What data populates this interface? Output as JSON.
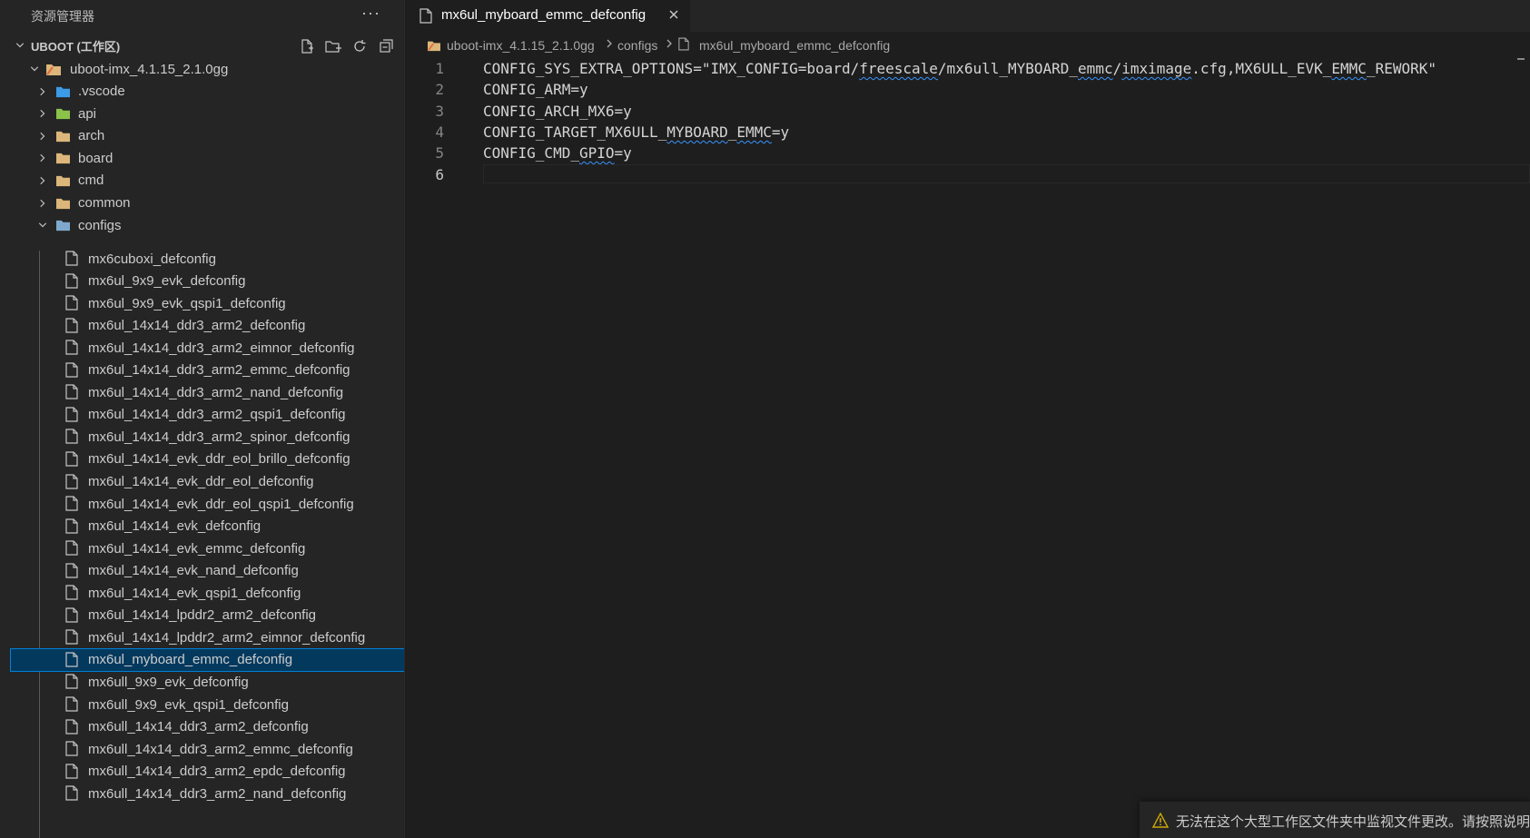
{
  "sidebar": {
    "title": "资源管理器",
    "more_label": "···",
    "workspace_label": "UBOOT (工作区)",
    "root_folder": "uboot-imx_4.1.15_2.1.0gg",
    "folders": [
      {
        "label": ".vscode",
        "icon": "vscode-folder-icon",
        "color": "#3c9be6"
      },
      {
        "label": "api",
        "icon": "api-folder-icon",
        "color": "#8bc34a"
      },
      {
        "label": "arch",
        "icon": "folder-icon",
        "color": "#dcb67a"
      },
      {
        "label": "board",
        "icon": "folder-icon",
        "color": "#dcb67a"
      },
      {
        "label": "cmd",
        "icon": "cmd-folder-icon",
        "color": "#dcb67a"
      },
      {
        "label": "common",
        "icon": "folder-icon",
        "color": "#dcb67a"
      },
      {
        "label": "configs",
        "icon": "config-folder-icon",
        "color": "#7fa9cc"
      }
    ],
    "files": [
      "mx6cuboxi_defconfig",
      "mx6ul_9x9_evk_defconfig",
      "mx6ul_9x9_evk_qspi1_defconfig",
      "mx6ul_14x14_ddr3_arm2_defconfig",
      "mx6ul_14x14_ddr3_arm2_eimnor_defconfig",
      "mx6ul_14x14_ddr3_arm2_emmc_defconfig",
      "mx6ul_14x14_ddr3_arm2_nand_defconfig",
      "mx6ul_14x14_ddr3_arm2_qspi1_defconfig",
      "mx6ul_14x14_ddr3_arm2_spinor_defconfig",
      "mx6ul_14x14_evk_ddr_eol_brillo_defconfig",
      "mx6ul_14x14_evk_ddr_eol_defconfig",
      "mx6ul_14x14_evk_ddr_eol_qspi1_defconfig",
      "mx6ul_14x14_evk_defconfig",
      "mx6ul_14x14_evk_emmc_defconfig",
      "mx6ul_14x14_evk_nand_defconfig",
      "mx6ul_14x14_evk_qspi1_defconfig",
      "mx6ul_14x14_lpddr2_arm2_defconfig",
      "mx6ul_14x14_lpddr2_arm2_eimnor_defconfig",
      "mx6ul_myboard_emmc_defconfig",
      "mx6ull_9x9_evk_defconfig",
      "mx6ull_9x9_evk_qspi1_defconfig",
      "mx6ull_14x14_ddr3_arm2_defconfig",
      "mx6ull_14x14_ddr3_arm2_emmc_defconfig",
      "mx6ull_14x14_ddr3_arm2_epdc_defconfig",
      "mx6ull_14x14_ddr3_arm2_nand_defconfig"
    ],
    "selected_file": "mx6ul_myboard_emmc_defconfig"
  },
  "editor": {
    "tab_label": "mx6ul_myboard_emmc_defconfig",
    "breadcrumb": [
      "uboot-imx_4.1.15_2.1.0gg",
      "configs",
      "mx6ul_myboard_emmc_defconfig"
    ],
    "lines": [
      {
        "num": "1",
        "parts": [
          {
            "t": "CONFIG_SYS_EXTRA_OPTIONS=\"IMX_CONFIG=board/"
          },
          {
            "t": "freescale",
            "sq": true
          },
          {
            "t": "/mx6ull_MYBOARD_"
          },
          {
            "t": "emmc",
            "sq": true
          },
          {
            "t": "/"
          },
          {
            "t": "imximage",
            "sq": true
          },
          {
            "t": ".cfg,MX6ULL_EVK_"
          },
          {
            "t": "EMMC",
            "sq": true
          },
          {
            "t": "_REWORK\""
          }
        ]
      },
      {
        "num": "2",
        "parts": [
          {
            "t": "CONFIG_ARM=y"
          }
        ]
      },
      {
        "num": "3",
        "parts": [
          {
            "t": "CONFIG_ARCH_MX6=y"
          }
        ]
      },
      {
        "num": "4",
        "parts": [
          {
            "t": "CONFIG_TARGET_MX6ULL_"
          },
          {
            "t": "MYBOARD",
            "sq": true
          },
          {
            "t": "_"
          },
          {
            "t": "EMMC",
            "sq": true
          },
          {
            "t": "=y"
          }
        ]
      },
      {
        "num": "5",
        "parts": [
          {
            "t": "CONFIG_CMD_"
          },
          {
            "t": "GPIO",
            "sq": true
          },
          {
            "t": "=y"
          }
        ]
      },
      {
        "num": "6",
        "parts": [
          {
            "t": ""
          }
        ]
      }
    ],
    "current_line": "6"
  },
  "notification": {
    "text": "无法在这个大型工作区文件夹中监视文件更改。请按照说明"
  }
}
